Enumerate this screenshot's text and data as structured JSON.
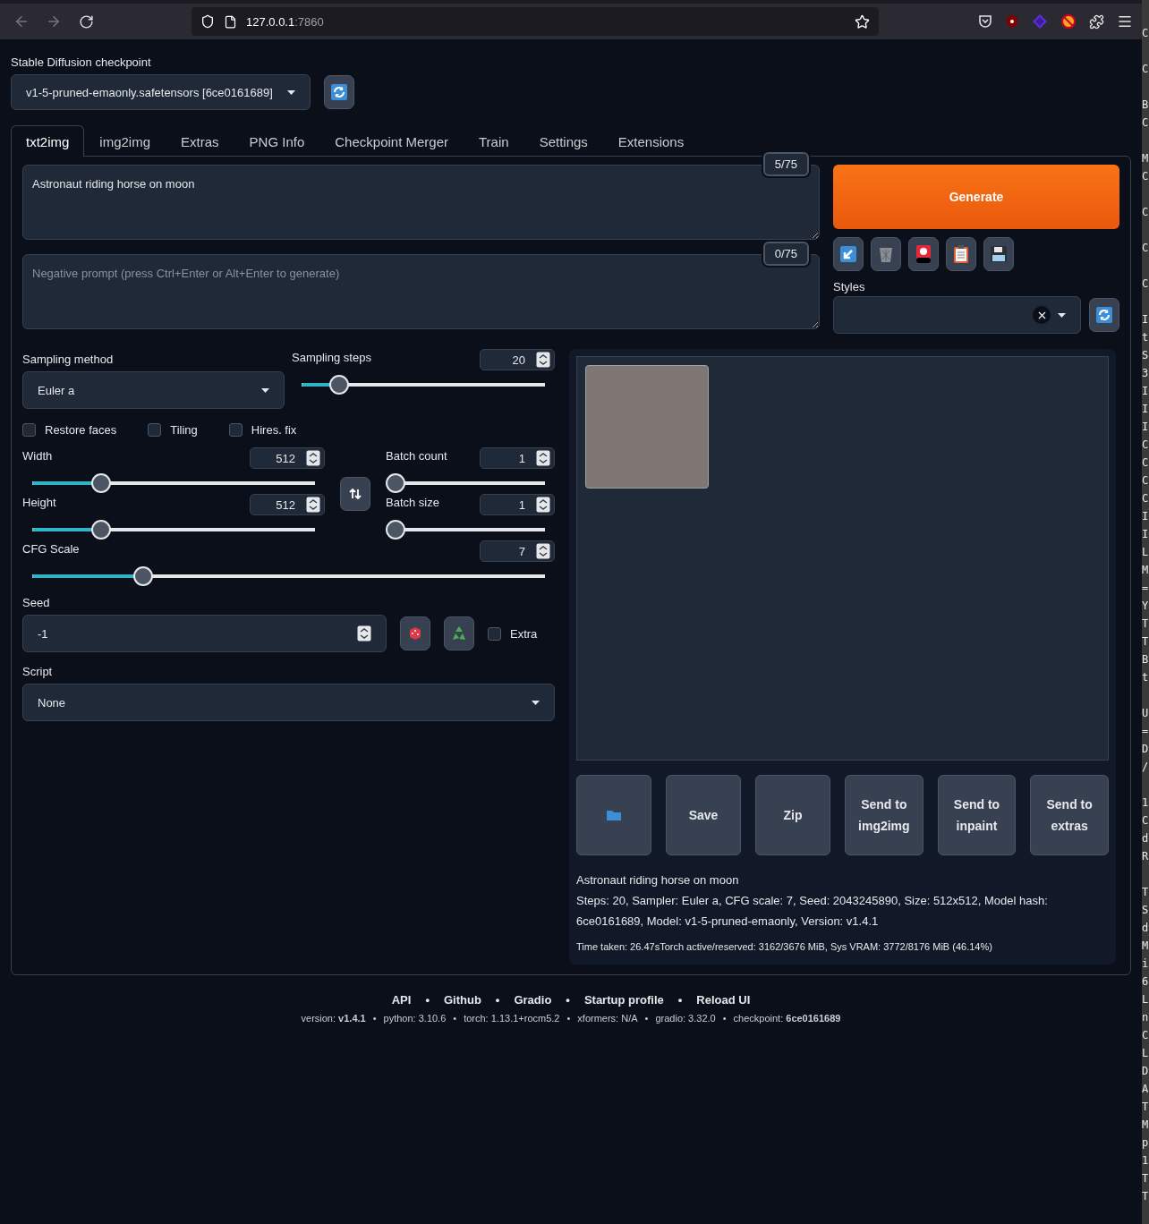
{
  "browser": {
    "url_host": "127.0.0.1",
    "url_port": ":7860"
  },
  "checkpoint": {
    "label": "Stable Diffusion checkpoint",
    "value": "v1-5-pruned-emaonly.safetensors [6ce0161689]"
  },
  "tabs": [
    {
      "label": "txt2img",
      "selected": true
    },
    {
      "label": "img2img",
      "selected": false
    },
    {
      "label": "Extras",
      "selected": false
    },
    {
      "label": "PNG Info",
      "selected": false
    },
    {
      "label": "Checkpoint Merger",
      "selected": false
    },
    {
      "label": "Train",
      "selected": false
    },
    {
      "label": "Settings",
      "selected": false
    },
    {
      "label": "Extensions",
      "selected": false
    }
  ],
  "prompt": {
    "value": "Astronaut riding horse on moon",
    "token_count": "5/75"
  },
  "negative_prompt": {
    "placeholder": "Negative prompt (press Ctrl+Enter or Alt+Enter to generate)",
    "token_count": "0/75"
  },
  "generate_button": "Generate",
  "styles": {
    "label": "Styles"
  },
  "sampling_method": {
    "label": "Sampling method",
    "value": "Euler a"
  },
  "sampling_steps": {
    "label": "Sampling steps",
    "value": "20",
    "level": 0.153
  },
  "checkboxes": [
    {
      "label": "Restore faces",
      "checked": false
    },
    {
      "label": "Tiling",
      "checked": false
    },
    {
      "label": "Hires. fix",
      "checked": false
    }
  ],
  "width": {
    "label": "Width",
    "value": "512",
    "level": 0.243
  },
  "height": {
    "label": "Height",
    "value": "512",
    "level": 0.243
  },
  "batch_count": {
    "label": "Batch count",
    "value": "1",
    "level": 0
  },
  "batch_size": {
    "label": "Batch size",
    "value": "1",
    "level": 0
  },
  "cfg_scale": {
    "label": "CFG Scale",
    "value": "7",
    "level": 0.217
  },
  "seed": {
    "label": "Seed",
    "value": "-1",
    "extra": {
      "label": "Extra",
      "checked": false
    }
  },
  "script": {
    "label": "Script",
    "value": "None"
  },
  "gallery_buttons": [
    {
      "kind": "folder"
    },
    {
      "kind": "text",
      "label": "Save"
    },
    {
      "kind": "text",
      "label": "Zip"
    },
    {
      "kind": "text",
      "label": "Send to img2img"
    },
    {
      "kind": "text",
      "label": "Send to inpaint"
    },
    {
      "kind": "text",
      "label": "Send to extras"
    }
  ],
  "info": {
    "prompt": "Astronaut riding horse on moon",
    "params": "Steps: 20, Sampler: Euler a, CFG scale: 7, Seed: 2043245890, Size: 512x512, Model hash: 6ce0161689, Model: v1-5-pruned-emaonly, Version: v1.4.1",
    "time": "Time taken: 26.47sTorch active/reserved: 3162/3676 MiB, Sys VRAM: 3772/8176 MiB (46.14%)"
  },
  "footer": {
    "separator": "•",
    "links": [
      "API",
      "Github",
      "Gradio",
      "Startup profile",
      "Reload UI"
    ],
    "versions": [
      "version: **v1.4.1**",
      "python: 3.10.6",
      "torch: 1.13.1+rocm5.2",
      "xformers: N/A",
      "gradio: 3.32.0",
      "checkpoint: **6ce0161689**"
    ]
  },
  "terminal_edge": [
    [
      "C"
    ],
    [
      "C"
    ],
    [
      "B",
      "C"
    ],
    [
      "M",
      "C"
    ],
    [
      "C"
    ],
    [
      "C"
    ],
    [
      "C"
    ],
    [
      "I",
      "t",
      "S",
      "3",
      "I",
      "I",
      "I",
      "C",
      "C",
      "C",
      "C",
      "I",
      "I",
      "L",
      "M",
      "=",
      "Y",
      "T",
      "T",
      "B",
      "t"
    ],
    [
      "U",
      "=",
      "D",
      "/"
    ],
    [
      "1",
      "C",
      "d",
      "R"
    ],
    [
      "T",
      "S",
      "d",
      "M",
      "i",
      "6",
      "L",
      "n",
      "C",
      "L",
      "D",
      "A",
      "T",
      "M",
      "p",
      "1",
      "T",
      "T"
    ]
  ]
}
